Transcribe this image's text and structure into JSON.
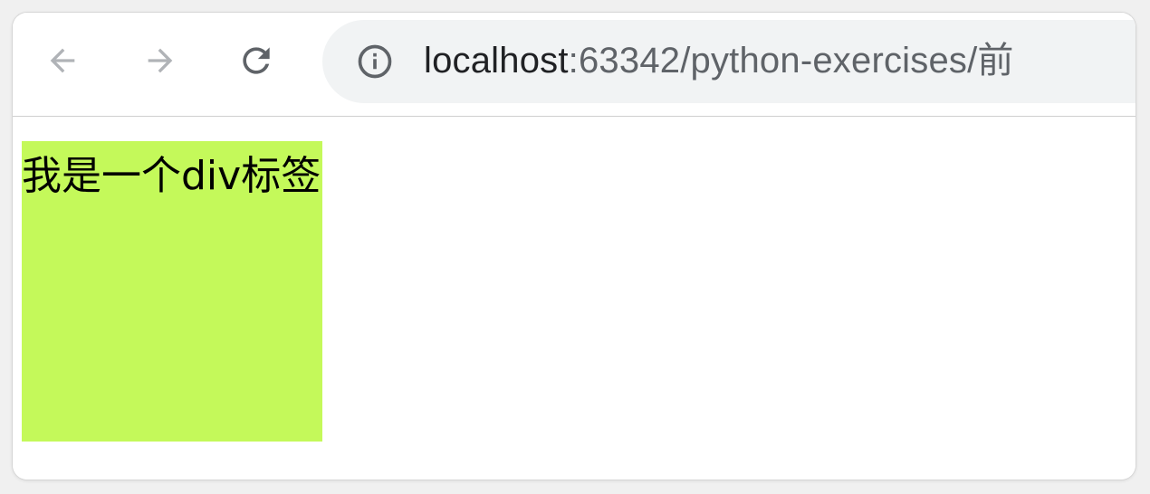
{
  "browser": {
    "url_host": "localhost",
    "url_rest": ":63342/python-exercises/前",
    "icons": {
      "back": "arrow-left-icon",
      "forward": "arrow-right-icon",
      "reload": "reload-icon",
      "site_info": "info-icon"
    }
  },
  "page": {
    "div_text": "我是一个div标签",
    "div_color": "#c4f95a"
  }
}
